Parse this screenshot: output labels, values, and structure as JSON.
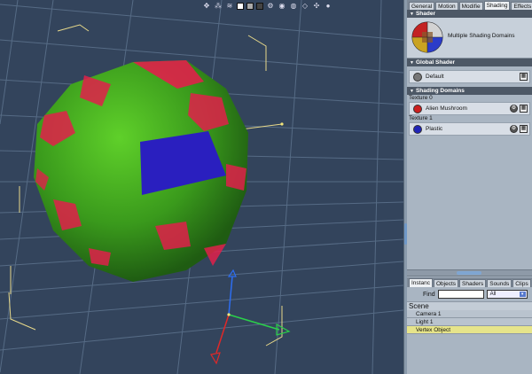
{
  "toolbar": {
    "icons": [
      "cursor-icon",
      "vertex-icon",
      "morph-icon",
      "swatch-white",
      "swatch-gray",
      "swatch-dark",
      "gear-icon",
      "camera-icon",
      "globe-icon",
      "cube-icon",
      "settings-icon",
      "sphere-icon"
    ]
  },
  "panel": {
    "tabs": [
      "General",
      "Motion",
      "Modifie",
      "Shading",
      "Effects"
    ],
    "active_tab": "Shading",
    "shader_section": "Shader",
    "shader_title": "Multiple Shading Domains",
    "global_shader_section": "Global Shader",
    "global_shader_name": "Default",
    "shading_domains_section": "Shading Domains",
    "domains": [
      {
        "label": "Texture 0",
        "name": "Alien Mushroom",
        "color": "#cc1f1f"
      },
      {
        "label": "Texture 1",
        "name": "Plastic",
        "color": "#2024b8"
      }
    ]
  },
  "browser": {
    "tabs": [
      "Instanc",
      "Objects",
      "Shaders",
      "Sounds",
      "Clips"
    ],
    "active_tab": "Instanc",
    "find_label": "Find",
    "find_value": "",
    "filter_value": "All",
    "scene_label": "Scene",
    "items": [
      "Camera 1",
      "Light 1",
      "Vertex Object"
    ],
    "selected_item": "Vertex Object"
  },
  "colors": {
    "viewport_bg": "#33445c",
    "grid": "#5a6e88",
    "bbox": "#e8d98a",
    "sphere_green": "#3fa51f",
    "sphere_red": "#e0204a",
    "face_blue": "#2a1fbf"
  }
}
